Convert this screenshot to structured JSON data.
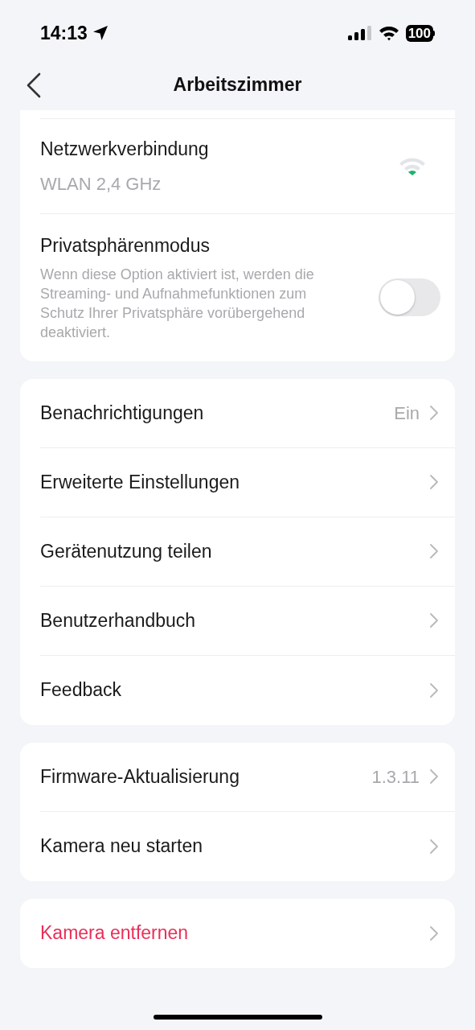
{
  "status_bar": {
    "time": "14:13",
    "battery": "100"
  },
  "nav": {
    "title": "Arbeitszimmer"
  },
  "groups": [
    {
      "cut_top": true,
      "rows": [
        {
          "kind": "network",
          "title": "Netzwerkverbindung",
          "value": "WLAN 2,4 GHz"
        },
        {
          "kind": "toggle",
          "title": "Privatsphärenmodus",
          "description": "Wenn diese Option aktiviert ist, werden die Streaming- und Aufnahmefunktionen zum Schutz Ihrer Privatsphäre vorübergehend deaktiviert.",
          "on": false
        }
      ]
    },
    {
      "rows": [
        {
          "kind": "link",
          "title": "Benachrichtigungen",
          "value": "Ein"
        },
        {
          "kind": "link",
          "title": "Erweiterte Einstellungen"
        },
        {
          "kind": "link",
          "title": "Gerätenutzung teilen"
        },
        {
          "kind": "link",
          "title": "Benutzerhandbuch"
        },
        {
          "kind": "link",
          "title": "Feedback"
        }
      ]
    },
    {
      "rows": [
        {
          "kind": "link",
          "title": "Firmware-Aktualisierung",
          "value": "1.3.11"
        },
        {
          "kind": "link",
          "title": "Kamera neu starten"
        }
      ]
    },
    {
      "rows": [
        {
          "kind": "danger",
          "title": "Kamera entfernen"
        }
      ]
    }
  ]
}
